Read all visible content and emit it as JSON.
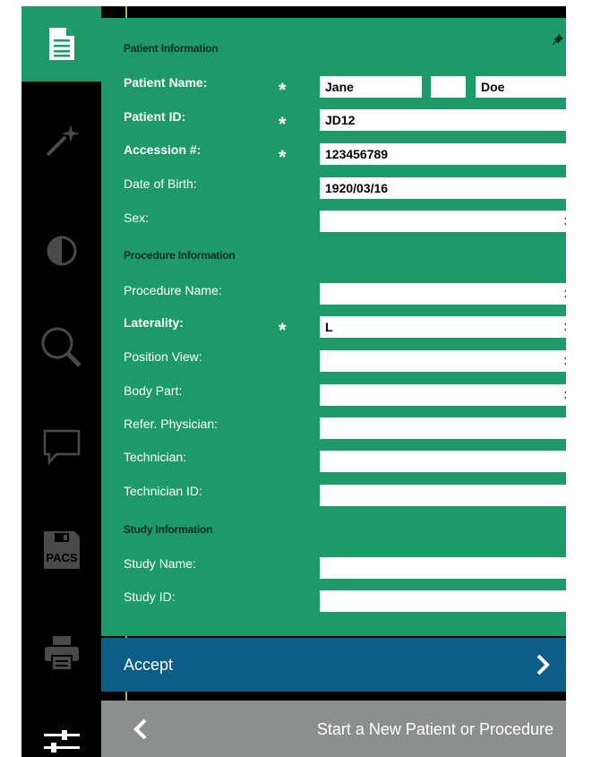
{
  "sidebar": {
    "items": [
      {
        "icon": "document-icon",
        "active": true
      },
      {
        "icon": "magic-wand-icon",
        "active": false
      },
      {
        "icon": "contrast-icon",
        "active": false
      },
      {
        "icon": "search-icon",
        "active": false
      },
      {
        "icon": "comment-icon",
        "active": false
      },
      {
        "icon": "pacs-save-icon",
        "label": "PACS",
        "active": false
      },
      {
        "icon": "print-icon",
        "active": false
      },
      {
        "icon": "sliders-icon",
        "active": false
      }
    ]
  },
  "form": {
    "patient_section": "Patient Information",
    "patient_name_label": "Patient Name:",
    "first_name": "Jane",
    "middle_name": "",
    "last_name": "Doe",
    "patient_id_label": "Patient ID:",
    "patient_id": "JD12",
    "accession_label": "Accession #:",
    "accession": "123456789",
    "dob_label": "Date of Birth:",
    "dob": "1920/03/16",
    "sex_label": "Sex:",
    "sex": "",
    "procedure_section": "Procedure Information",
    "procedure_name_label": "Procedure Name:",
    "procedure_name": "",
    "laterality_label": "Laterality:",
    "laterality": "L",
    "position_view_label": "Position View:",
    "position_view": "",
    "body_part_label": "Body Part:",
    "body_part": "",
    "refer_physician_label": "Refer. Physician:",
    "refer_physician": "",
    "technician_label": "Technician:",
    "technician": "",
    "technician_id_label": "Technician ID:",
    "technician_id": "",
    "study_section": "Study Information",
    "study_name_label": "Study Name:",
    "study_name": "",
    "study_id_label": "Study ID:",
    "study_id": "",
    "required_marker": "*"
  },
  "actions": {
    "accept": "Accept",
    "new_patient": "Start a New Patient or Procedure"
  },
  "colors": {
    "panel": "#1e9a68",
    "accept": "#0d5e86",
    "back": "#8d8e8e",
    "select_arrow": "#246f86"
  }
}
